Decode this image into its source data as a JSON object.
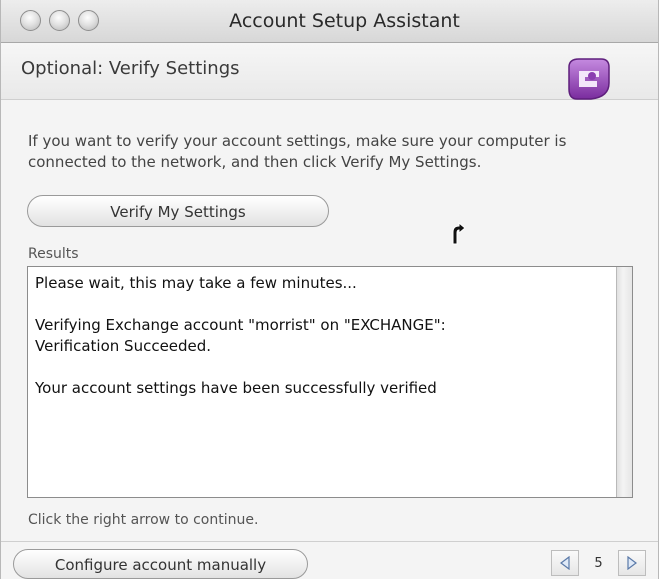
{
  "window": {
    "title": "Account Setup Assistant"
  },
  "header": {
    "title": "Optional: Verify Settings",
    "logo_icon": "exchange-logo-icon"
  },
  "main": {
    "instructions": "If you want to verify your account settings, make sure your computer is connected to the network, and then click Verify My Settings.",
    "verify_button": "Verify My Settings",
    "results_label": "Results",
    "results_lines": [
      "Please wait, this may take a few minutes...",
      "Verifying Exchange account \"morrist\" on \"EXCHANGE\":",
      "Verification Succeeded.",
      "Your account settings have been successfully verified"
    ],
    "continue_hint": "Click the right arrow to continue."
  },
  "footer": {
    "manual_button": "Configure account manually",
    "page_number": "5"
  },
  "colors": {
    "logo_purple": "#8a3db0",
    "window_bg": "#f4f4f4"
  }
}
